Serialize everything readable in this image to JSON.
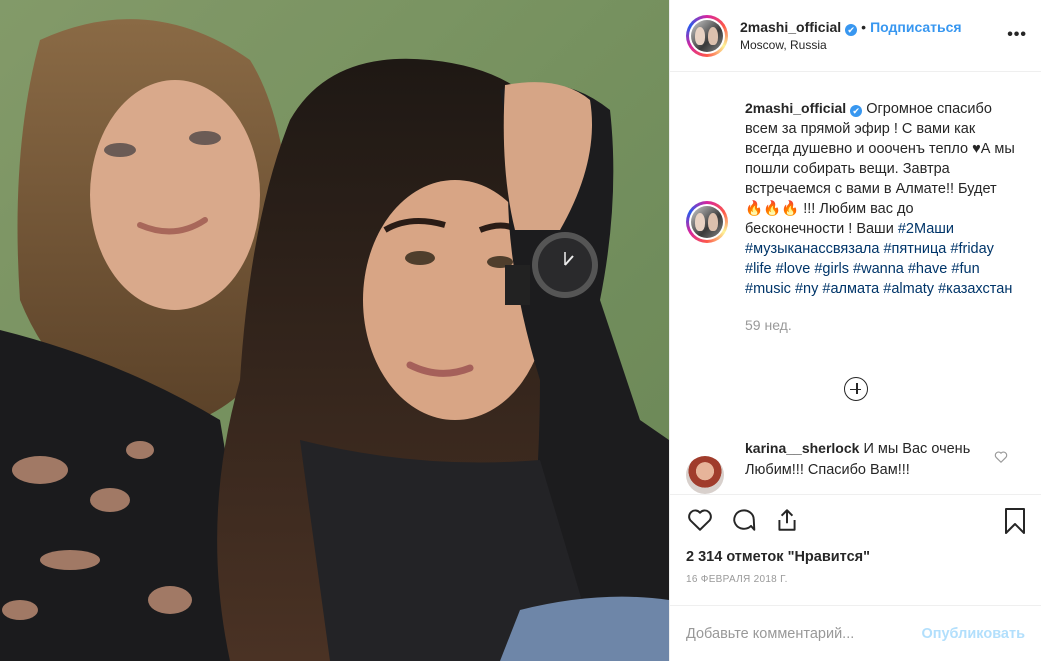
{
  "post": {
    "username": "2mashi_official",
    "verified_mark": "✔",
    "follow_label": "Подписаться",
    "location": "Moscow, Russia",
    "more_icon": "•••"
  },
  "caption": {
    "username": "2mashi_official",
    "text_1": "Огромное спасибо всем за прямой эфир ! С вами как всегда душевно и оооченъ тепло ♥А мы пошли собирать вещи. Завтра встречаемся с вами в Алмате!! Будет 🔥🔥🔥 !!! Любим вас до бесконечности ! Ваши ",
    "hashtags": [
      "#2Маши",
      "#музыканассвязала",
      "#пятница",
      "#friday",
      "#life",
      "#love",
      "#girls",
      "#wanna",
      "#have",
      "#fun",
      "#music",
      "#ny",
      "#алмата",
      "#almaty",
      "#казахстан"
    ],
    "time": "59 нед."
  },
  "comment": {
    "username": "karina__sherlock",
    "text": "И мы Вас очень Любим!!! Спасибо Вам!!!"
  },
  "likes": "2 314 отметок \"Нравится\"",
  "date": "16 ФЕВРАЛЯ 2018 Г.",
  "add_comment": {
    "placeholder": "Добавьте комментарий...",
    "publish": "Опубликовать"
  },
  "colors": {
    "link": "#3897f0",
    "hashtag": "#003569",
    "muted": "#999999",
    "publish_disabled": "#b2dffc"
  }
}
